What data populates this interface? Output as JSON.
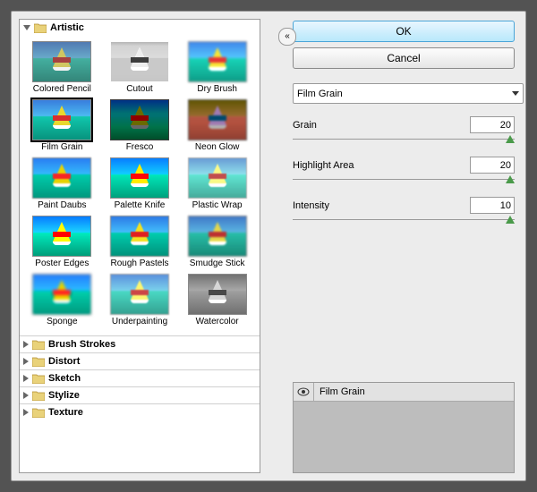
{
  "buttons": {
    "ok": "OK",
    "cancel": "Cancel"
  },
  "collapse_glyph": "«",
  "categories": {
    "open": "Artistic",
    "closed": [
      "Brush Strokes",
      "Distort",
      "Sketch",
      "Stylize",
      "Texture"
    ]
  },
  "filters": [
    {
      "label": "Colored Pencil",
      "variant": "v0"
    },
    {
      "label": "Cutout",
      "variant": "v1"
    },
    {
      "label": "Dry Brush",
      "variant": "v2"
    },
    {
      "label": "Film Grain",
      "variant": "v3",
      "selected": true
    },
    {
      "label": "Fresco",
      "variant": "v4"
    },
    {
      "label": "Neon Glow",
      "variant": "v5"
    },
    {
      "label": "Paint Daubs",
      "variant": "v6"
    },
    {
      "label": "Palette Knife",
      "variant": "v7"
    },
    {
      "label": "Plastic Wrap",
      "variant": "v8"
    },
    {
      "label": "Poster Edges",
      "variant": "v9"
    },
    {
      "label": "Rough Pastels",
      "variant": "v10"
    },
    {
      "label": "Smudge Stick",
      "variant": "v11"
    },
    {
      "label": "Sponge",
      "variant": "v12"
    },
    {
      "label": "Underpainting",
      "variant": "v13"
    },
    {
      "label": "Watercolor",
      "variant": "v14"
    }
  ],
  "selected_filter": "Film Grain",
  "params": [
    {
      "label": "Grain",
      "value": 20,
      "pos": 98
    },
    {
      "label": "Highlight Area",
      "value": 20,
      "pos": 98
    },
    {
      "label": "Intensity",
      "value": 10,
      "pos": 98
    }
  ],
  "layer": {
    "name": "Film Grain"
  }
}
